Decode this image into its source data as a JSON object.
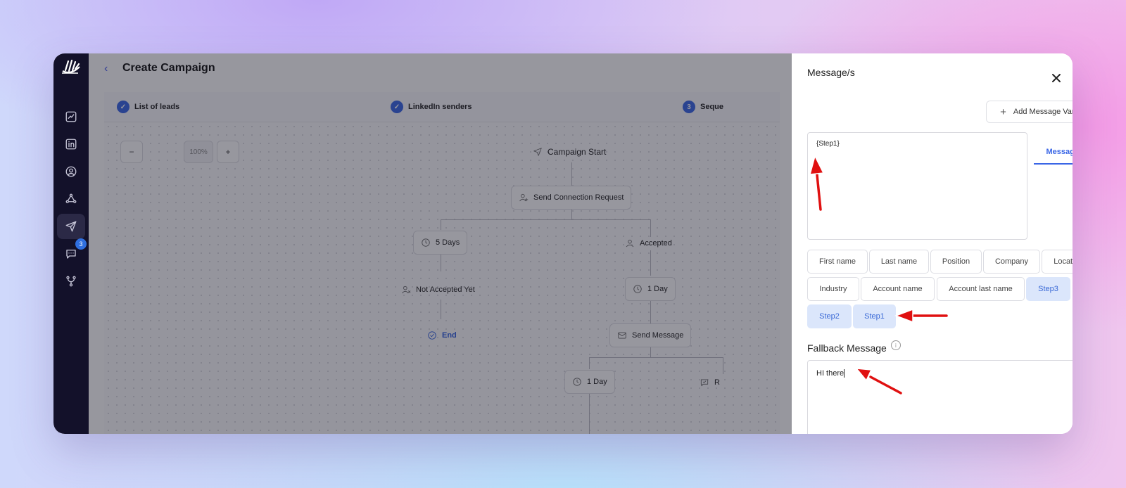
{
  "app": {
    "page_title": "Create Campaign"
  },
  "sidebar": {
    "items": [
      {
        "icon": "analytics-icon"
      },
      {
        "icon": "linkedin-icon"
      },
      {
        "icon": "user-circle-icon"
      },
      {
        "icon": "network-icon"
      },
      {
        "icon": "send-icon",
        "active": true
      },
      {
        "icon": "chat-icon",
        "badge": "3"
      },
      {
        "icon": "branch-icon"
      }
    ]
  },
  "steps": [
    {
      "label": "List of leads",
      "state": "done"
    },
    {
      "label": "LinkedIn senders",
      "state": "done"
    },
    {
      "label": "Seque",
      "state": "current",
      "number": "3"
    }
  ],
  "zoom": {
    "minus": "−",
    "value": "100%",
    "plus": "+"
  },
  "flow": {
    "start": "Campaign Start",
    "connect": "Send Connection Request",
    "wait5": "5 Days",
    "accepted": "Accepted",
    "not_accepted": "Not Accepted Yet",
    "wait1a": "1 Day",
    "end": "End",
    "send_message": "Send Message",
    "wait1b": "1 Day",
    "partial": "R"
  },
  "panel": {
    "title": "Message/s",
    "add_variation": "Add Message Variation",
    "message_text": "{Step1}",
    "message_tab": "Message A",
    "variables": [
      "First name",
      "Last name",
      "Position",
      "Company",
      "Location",
      "Industry",
      "Account name",
      "Account last name",
      "Step3",
      "Step2",
      "Step1"
    ],
    "fallback_label": "Fallback Message",
    "fallback_text": "HI there"
  },
  "colors": {
    "accent": "#3a66e6",
    "sidebar_bg": "#13112a",
    "chip_blue": "#dbe6fb",
    "arrow": "#e01010"
  }
}
